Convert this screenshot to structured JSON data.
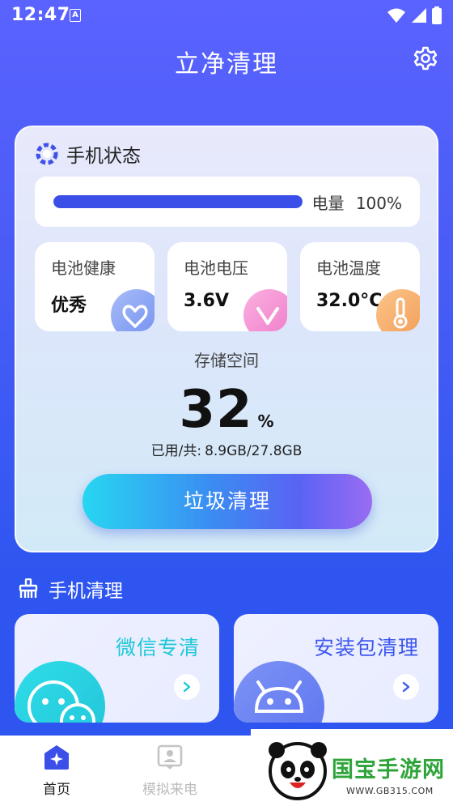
{
  "status_bar": {
    "time": "12:47",
    "notification_letter": "A"
  },
  "header": {
    "title": "立净清理",
    "settings_icon": "gear-icon"
  },
  "phone_status": {
    "title": "手机状态",
    "battery": {
      "label": "电量",
      "value": "100%",
      "level": 1.0
    },
    "metrics": [
      {
        "label": "电池健康",
        "value": "优秀",
        "icon": "heart-icon",
        "color": "#7f9bf2"
      },
      {
        "label": "电池电压",
        "value": "3.6V",
        "icon": "check-v-icon",
        "color": "#f58fd0"
      },
      {
        "label": "电池温度",
        "value": "32.0°C",
        "icon": "thermometer-icon",
        "color": "#f6ad6a"
      }
    ],
    "storage": {
      "label": "存储空间",
      "percent": "32",
      "percent_unit": "%",
      "used_label": "已用/共:",
      "used_value": "8.9GB/27.8GB"
    },
    "clean_button": "垃圾清理"
  },
  "phone_clean": {
    "title": "手机清理",
    "cards": [
      {
        "title": "微信专清",
        "icon": "wechat-icon"
      },
      {
        "title": "安装包清理",
        "icon": "android-icon"
      }
    ]
  },
  "bottom_nav": {
    "items": [
      {
        "label": "首页",
        "icon": "home-star-icon",
        "active": true
      },
      {
        "label": "模拟来电",
        "icon": "contact-card-icon",
        "active": false
      }
    ]
  },
  "watermark": {
    "brand": "国宝手游网",
    "url": "WWW.GB315.COM"
  },
  "colors": {
    "accent": "#3b4ee8",
    "cyan": "#1ec8d8",
    "background": "#3a5af3"
  }
}
